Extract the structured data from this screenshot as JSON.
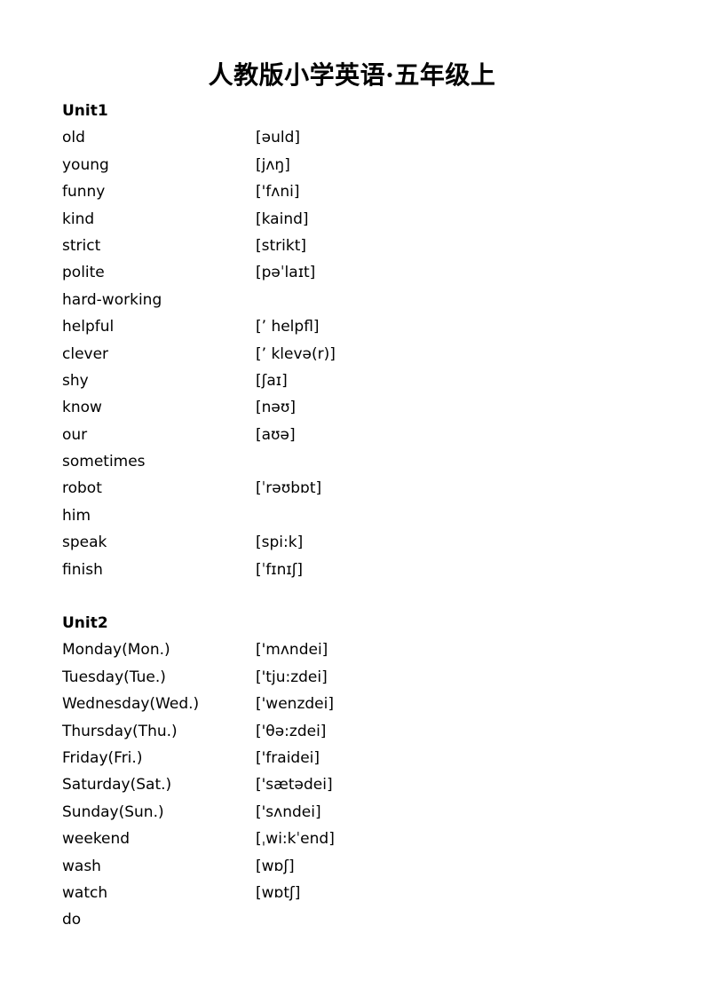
{
  "document": {
    "title": "人教版小学英语·五年级上"
  },
  "units": [
    {
      "heading": "Unit1",
      "entries": [
        {
          "word": "old",
          "phonetic": "[əuld]"
        },
        {
          "word": "young",
          "phonetic": "[jʌŋ]"
        },
        {
          "word": "funny",
          "phonetic": "['fʌni]"
        },
        {
          "word": "kind",
          "phonetic": "[kaind]"
        },
        {
          "word": "strict",
          "phonetic": "[strikt]"
        },
        {
          "word": "polite",
          "phonetic": "[pəˈlaɪt]"
        },
        {
          "word": "hard-working",
          "phonetic": ""
        },
        {
          "word": "helpful",
          "phonetic": "[’ helpfl]"
        },
        {
          "word": "clever",
          "phonetic": "[’ klevə(r)]"
        },
        {
          "word": "shy",
          "phonetic": "[ʃaɪ]"
        },
        {
          "word": "know",
          "phonetic": "[nəʊ]"
        },
        {
          "word": "our",
          "phonetic": "[aʊə]"
        },
        {
          "word": "sometimes",
          "phonetic": ""
        },
        {
          "word": "robot",
          "phonetic": "[ˈrəʊbɒt]"
        },
        {
          "word": "him",
          "phonetic": ""
        },
        {
          "word": "speak",
          "phonetic": "[spi:k]"
        },
        {
          "word": "finish",
          "phonetic": "[ˈfɪnɪʃ]"
        }
      ]
    },
    {
      "heading": "Unit2",
      "entries": [
        {
          "word": "Monday(Mon.)",
          "phonetic": "['mʌndei]"
        },
        {
          "word": "Tuesday(Tue.)",
          "phonetic": "['tju:zdei]"
        },
        {
          "word": "Wednesday(Wed.)",
          "phonetic": "['wenzdei]"
        },
        {
          "word": "Thursday(Thu.)",
          "phonetic": "['θə:zdei]"
        },
        {
          "word": "Friday(Fri.)",
          "phonetic": "['fraidei]"
        },
        {
          "word": "Saturday(Sat.)",
          "phonetic": "['sætədei]"
        },
        {
          "word": "Sunday(Sun.)",
          "phonetic": "['sʌndei]"
        },
        {
          "word": "weekend",
          "phonetic": "[ˌwi:kˈend]"
        },
        {
          "word": "wash",
          "phonetic": "[wɒʃ]"
        },
        {
          "word": "watch",
          "phonetic": "[wɒtʃ]"
        },
        {
          "word": "do",
          "phonetic": ""
        }
      ]
    }
  ]
}
